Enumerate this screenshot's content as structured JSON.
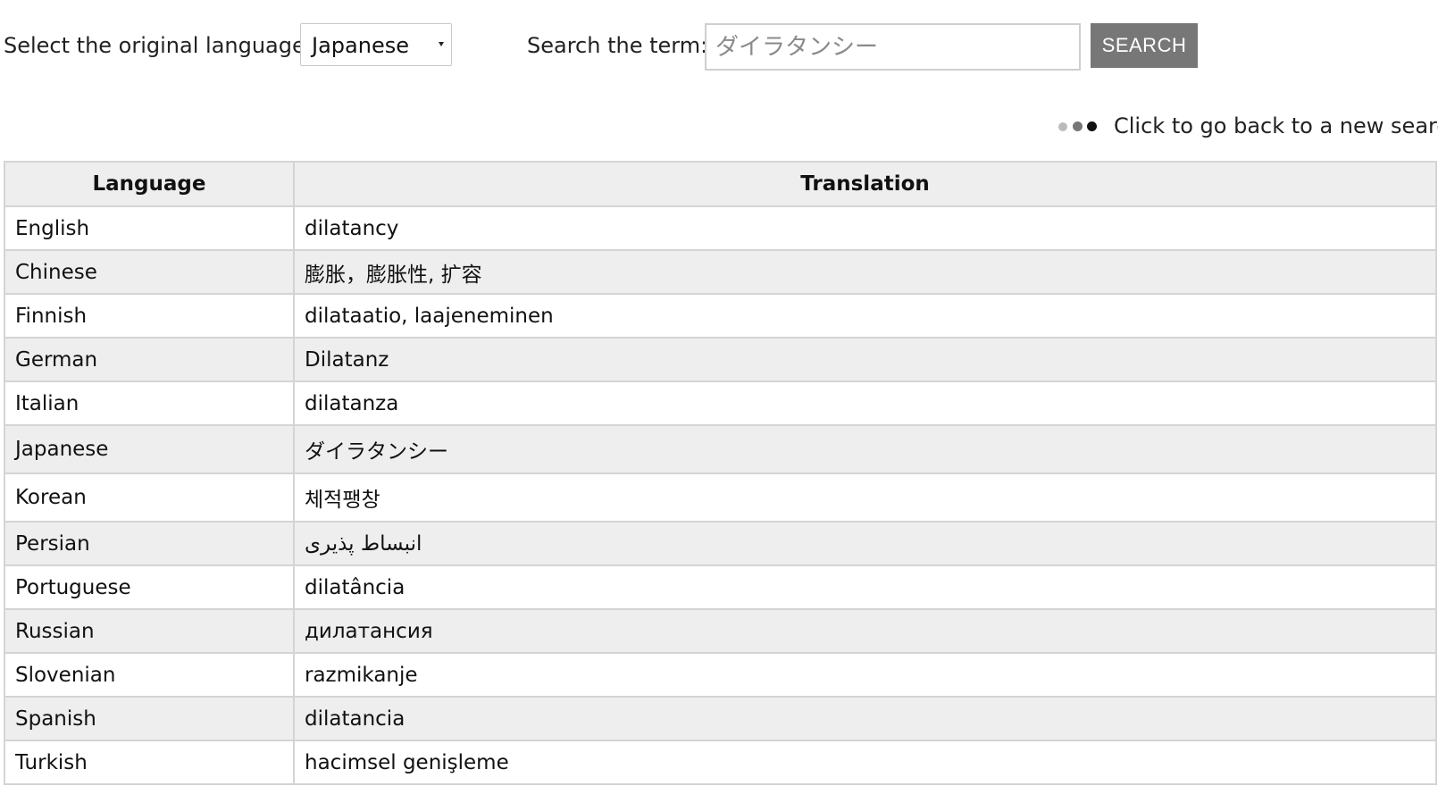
{
  "search": {
    "language_label": "Select the original language:",
    "language_selected": "Japanese",
    "term_label": "Search the term:",
    "term_placeholder": "ダイラタンシー",
    "search_button_label": "SEARCH"
  },
  "back_link": {
    "label": "Click to go back to a new search",
    "icon": "three-dots-icon"
  },
  "table": {
    "headers": [
      "Language",
      "Translation"
    ],
    "rows": [
      {
        "language": "English",
        "translation": "dilatancy"
      },
      {
        "language": "Chinese",
        "translation": "膨胀，膨胀性, 扩容"
      },
      {
        "language": "Finnish",
        "translation": "dilataatio, laajeneminen"
      },
      {
        "language": "German",
        "translation": "Dilatanz"
      },
      {
        "language": "Italian",
        "translation": "dilatanza"
      },
      {
        "language": "Japanese",
        "translation": "ダイラタンシー"
      },
      {
        "language": "Korean",
        "translation": "체적팽창"
      },
      {
        "language": "Persian",
        "translation": "انبساط پذیری"
      },
      {
        "language": "Portuguese",
        "translation": "dilatância"
      },
      {
        "language": "Russian",
        "translation": "дилатансия"
      },
      {
        "language": "Slovenian",
        "translation": "razmikanje"
      },
      {
        "language": "Spanish",
        "translation": "dilatancia"
      },
      {
        "language": "Turkish",
        "translation": "hacimsel genişleme"
      }
    ]
  },
  "colors": {
    "button_bg": "#777777",
    "row_alt_bg": "#eeeeee",
    "border": "#d4d4d4"
  }
}
